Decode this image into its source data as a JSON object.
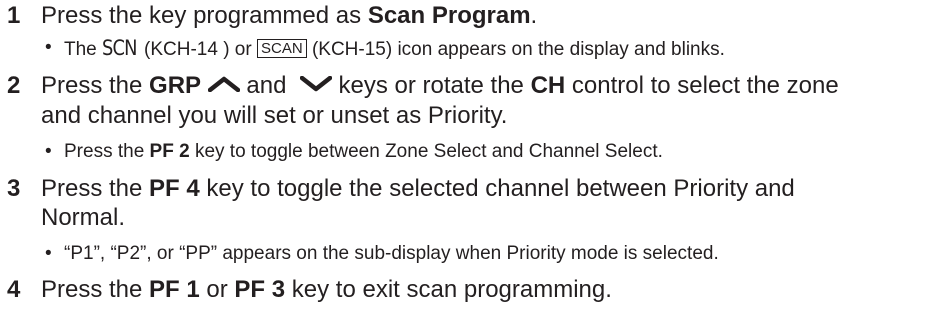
{
  "steps": [
    {
      "number": "1",
      "parts": {
        "a": "Press the key programmed as ",
        "b": "Scan Program",
        "c": "."
      },
      "sub": {
        "bullet": "•",
        "a": "The ",
        "scn": "SCN",
        "b": " (KCH-14 ) or ",
        "scan": "SCAN",
        "c": " (KCH-15) icon appears on the display and blinks."
      }
    },
    {
      "number": "2",
      "parts": {
        "a": "Press the ",
        "b": "GRP",
        "c": " and ",
        "d": " keys or rotate the ",
        "e": "CH",
        "f": " control to select the zone",
        "g": "and channel you will set or unset as Priority."
      },
      "sub": {
        "bullet": "•",
        "a": "Press the ",
        "b": "PF 2",
        "c": " key to toggle between Zone Select and Channel Select."
      }
    },
    {
      "number": "3",
      "parts": {
        "a": "Press the ",
        "b": "PF 4",
        "c": " key to toggle the selected channel between Priority and",
        "d": "Normal."
      },
      "sub": {
        "bullet": "•",
        "a": "“P1”, “P2”, or “PP” appears on the sub-display when Priority mode is selected."
      }
    },
    {
      "number": "4",
      "parts": {
        "a": "Press the ",
        "b": "PF 1",
        "c": " or ",
        "d": "PF 3",
        "e": " key to exit scan programming."
      }
    }
  ],
  "icons": {
    "up": "chevron-up-icon",
    "down": "chevron-down-icon"
  }
}
